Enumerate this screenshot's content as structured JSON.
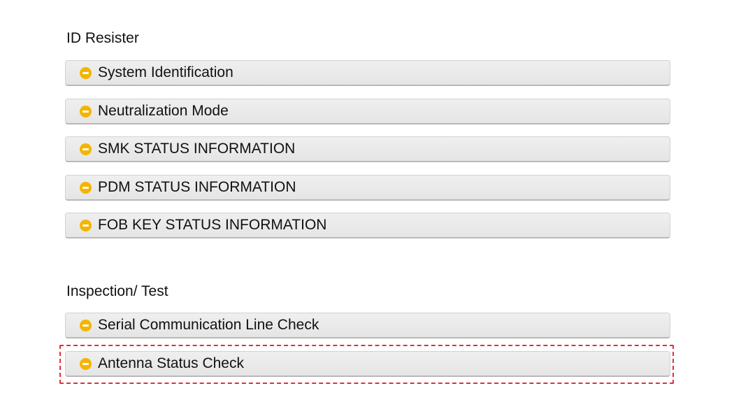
{
  "sections": [
    {
      "title": "ID Resister",
      "items": [
        {
          "label": "System Identification",
          "icon": "bullet-arrow-icon"
        },
        {
          "label": "Neutralization Mode",
          "icon": "bullet-arrow-icon"
        },
        {
          "label": "SMK STATUS INFORMATION",
          "icon": "bullet-arrow-icon"
        },
        {
          "label": "PDM STATUS INFORMATION",
          "icon": "bullet-arrow-icon"
        },
        {
          "label": "FOB KEY STATUS INFORMATION",
          "icon": "bullet-arrow-icon"
        }
      ]
    },
    {
      "title": "Inspection/ Test",
      "items": [
        {
          "label": "Serial Communication Line Check",
          "icon": "bullet-arrow-icon"
        },
        {
          "label": "Antenna Status Check",
          "icon": "bullet-arrow-icon",
          "highlighted": true
        }
      ]
    }
  ],
  "colors": {
    "bullet": "#f5b400",
    "highlight_border": "#e0303a",
    "item_background": "#ebebeb"
  }
}
